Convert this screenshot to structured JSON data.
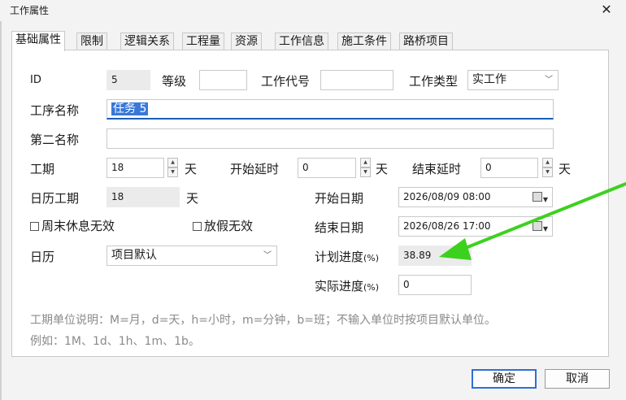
{
  "window": {
    "title": "工作属性",
    "close_icon": "close-icon"
  },
  "tabs": [
    "基础属性",
    "限制",
    "逻辑关系",
    "工程量",
    "资源",
    "工作信息",
    "施工条件",
    "路桥项目"
  ],
  "form": {
    "id_label": "ID",
    "id_value": "5",
    "level_label": "等级",
    "level_value": "",
    "code_label": "工作代号",
    "code_value": "",
    "type_label": "工作类型",
    "type_value": "实工作",
    "name_label": "工序名称",
    "name_value": "任务 5",
    "second_name_label": "第二名称",
    "second_name_value": "",
    "duration_label": "工期",
    "duration_value": "18",
    "start_delay_label": "开始延时",
    "start_delay_value": "0",
    "end_delay_label": "结束延时",
    "end_delay_value": "0",
    "unit_day": "天",
    "calendar_duration_label": "日历工期",
    "calendar_duration_value": "18",
    "start_date_label": "开始日期",
    "start_date_value": "2026/08/09 08:00",
    "weekend_checkbox": "周末休息无效",
    "holiday_checkbox": "放假无效",
    "end_date_label": "结束日期",
    "end_date_value": "2026/08/26 17:00",
    "calendar_label": "日历",
    "calendar_value": "项目默认",
    "plan_progress_label": "计划进度",
    "plan_progress_unit": "(%)",
    "plan_progress_value": "38.89",
    "actual_progress_label": "实际进度",
    "actual_progress_unit": "(%)",
    "actual_progress_value": "0"
  },
  "hints": {
    "line1": "工期单位说明：M=月，d=天，h=小时，m=分钟，b=班；不输入单位时按项目默认单位。",
    "line2": "例如：1M、1d、1h、1m、1b。"
  },
  "buttons": {
    "ok": "确定",
    "cancel": "取消"
  },
  "colors": {
    "arrow": "#3dd11f",
    "accent": "#2f6fd4",
    "selection": "#3a78d8"
  }
}
